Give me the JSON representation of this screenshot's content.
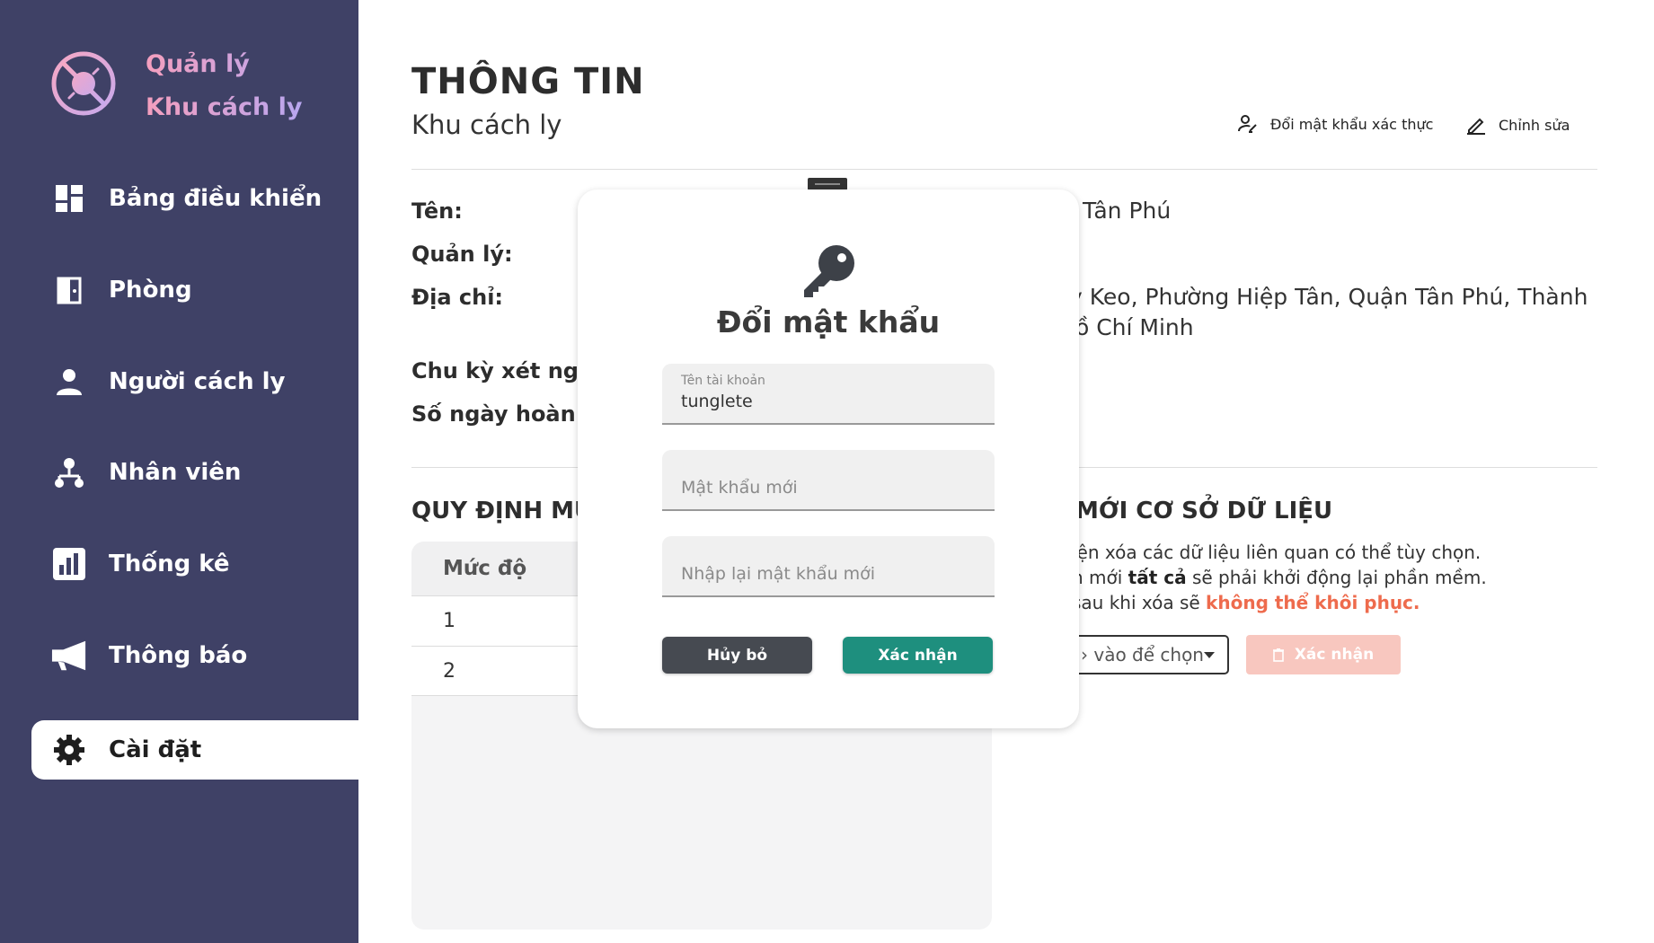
{
  "brand": {
    "line1": "Quản lý",
    "line2": "Khu cách ly"
  },
  "sidebar": {
    "items": [
      {
        "label": "Bảng điều khiển",
        "icon": "dashboard-icon"
      },
      {
        "label": "Phòng",
        "icon": "room-icon"
      },
      {
        "label": "Người cách ly",
        "icon": "person-icon"
      },
      {
        "label": "Nhân viên",
        "icon": "staff-icon"
      },
      {
        "label": "Thống kê",
        "icon": "chart-icon"
      },
      {
        "label": "Thông báo",
        "icon": "megaphone-icon"
      },
      {
        "label": "Cài đặt",
        "icon": "gear-icon",
        "active": true
      }
    ]
  },
  "header": {
    "title": "THÔNG TIN",
    "subtitle": "Khu cách ly",
    "change_password_label": "Đổi mật khẩu xác thực",
    "edit_label": "Chỉnh sửa"
  },
  "info": {
    "name_label": "Tên:",
    "name_value": "Tân Phú",
    "manager_label": "Quản lý:",
    "address_label": "Địa chỉ:",
    "address_line1": "y Keo, Phường Hiệp Tân, Quận Tân Phú, Thành",
    "address_line2": "lồ Chí Minh",
    "test_cycle_label": "Chu kỳ xét ngh",
    "days_label": "Số ngày hoàn th"
  },
  "rules": {
    "section_title": "QUY ĐỊNH MỨ",
    "header": "Mức độ",
    "rows": [
      "1",
      "2"
    ]
  },
  "db_reset": {
    "section_title": "MỚI CƠ SỞ DỮ LIỆU",
    "desc1": "iện xóa các dữ liệu liên quan có thể tùy chọn.",
    "desc2_pre": "n mới ",
    "desc2_bold": "tất cả",
    "desc2_post": " sẽ phải khởi động lại phần mềm.",
    "desc3_pre": " sau khi xóa sẽ ",
    "desc3_warn": "không thể khôi phục.",
    "select_placeholder": "› vào để chọn",
    "confirm_label": "Xác nhận"
  },
  "modal": {
    "title": "Đổi mật khẩu",
    "username_label": "Tên tài khoản",
    "username_value": "tunglete",
    "new_password_placeholder": "Mật khẩu mới",
    "confirm_password_placeholder": "Nhập lại mật khẩu mới",
    "cancel_label": "Hủy bỏ",
    "confirm_label": "Xác nhận"
  },
  "colors": {
    "sidebar_bg": "#3f4166",
    "accent_teal": "#1e8f7e",
    "danger_light": "#f8c7bf",
    "warning_text": "#ee6b4d"
  }
}
